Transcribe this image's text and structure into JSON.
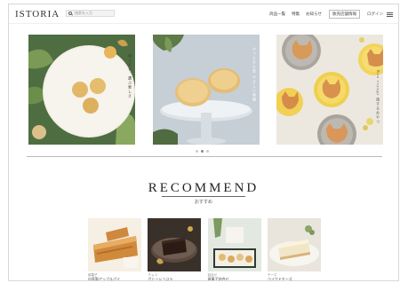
{
  "header": {
    "logo": "ISTORIA",
    "search_placeholder": "検索を入力",
    "nav": [
      {
        "label": "商品一覧"
      },
      {
        "label": "特集"
      },
      {
        "label": "お知らせ"
      }
    ],
    "store_button": "販売店舗情報",
    "login": "ログイン"
  },
  "hero": {
    "panels": [
      {
        "caption": "贈る幸せ、選ぶ楽しさ"
      },
      {
        "caption": "ホッとひと息 やさしい時間"
      },
      {
        "caption": "Bon voyage 旅するおやつ"
      }
    ],
    "dots": 3,
    "active_dot": 1
  },
  "recommend": {
    "title": "RECOMMEND",
    "subtitle": "おすすめ"
  },
  "products": [
    {
      "category": "焼菓子",
      "name": "自家製アップルパイ"
    },
    {
      "category": "チョコ",
      "name": "ガトーショコラ"
    },
    {
      "category": "詰合せ",
      "name": "焼菓子詰合せ"
    },
    {
      "category": "チーズ",
      "name": "ベイクドチーズ"
    }
  ],
  "colors": {
    "accent": "#333333",
    "divider": "#bbbbbb"
  }
}
